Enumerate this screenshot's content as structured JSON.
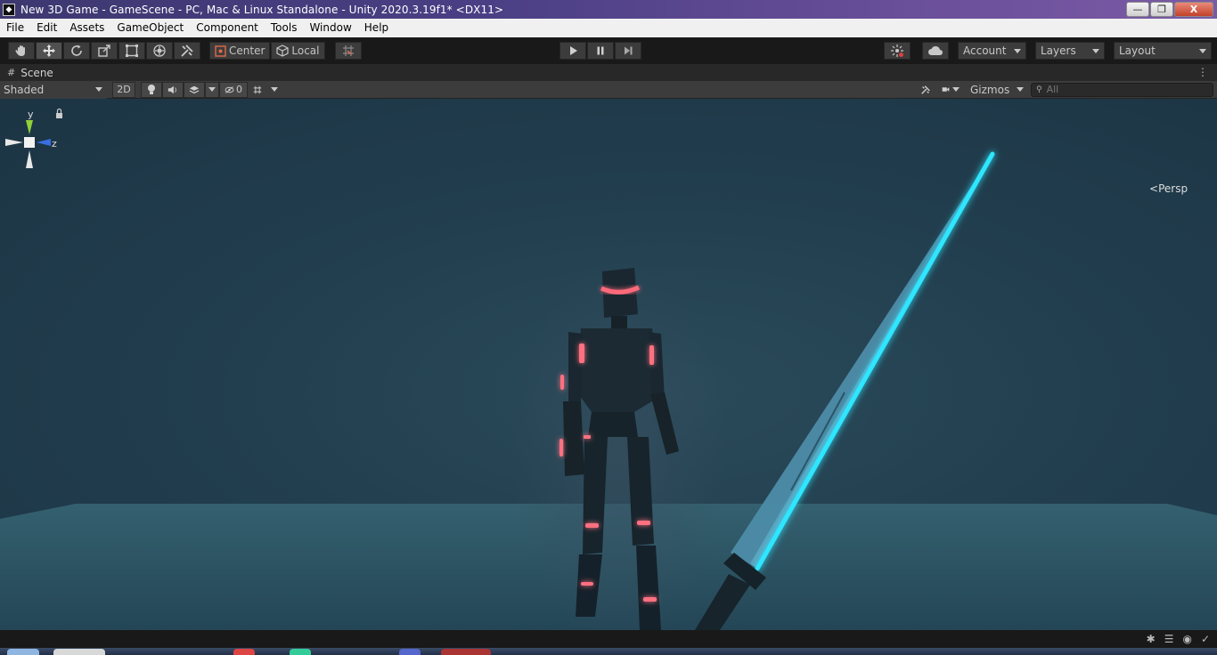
{
  "window": {
    "title": "New 3D Game - GameScene - PC, Mac & Linux Standalone - Unity 2020.3.19f1* <DX11>",
    "minimize": "—",
    "maximize": "❐",
    "close": "X"
  },
  "menu": [
    "File",
    "Edit",
    "Assets",
    "GameObject",
    "Component",
    "Tools",
    "Window",
    "Help"
  ],
  "toolbar": {
    "pivot_label": "Center",
    "space_label": "Local",
    "account_label": "Account",
    "layers_label": "Layers",
    "layout_label": "Layout"
  },
  "scene_tab": {
    "label": "Scene",
    "menu_icon": "⋮"
  },
  "scene_toolbar": {
    "draw_mode": "Shaded",
    "mode_2d": "2D",
    "hidden_count": "0",
    "gizmos_label": "Gizmos",
    "search_placeholder": "All"
  },
  "orientation_gizmo": {
    "y_label": "y",
    "z_label": "z",
    "projection": "Persp",
    "colors": {
      "y": "#8ed13a",
      "z": "#3a6fe0",
      "neutral": "#e8e8e8"
    }
  },
  "scene_colors": {
    "background": "#223f4f",
    "floor": "#2f5a6b",
    "character": "#1a2730",
    "character_glow": "#ff6a7a",
    "blade_edge": "#2ee6ff",
    "blade_body": "#4d8ca8"
  }
}
